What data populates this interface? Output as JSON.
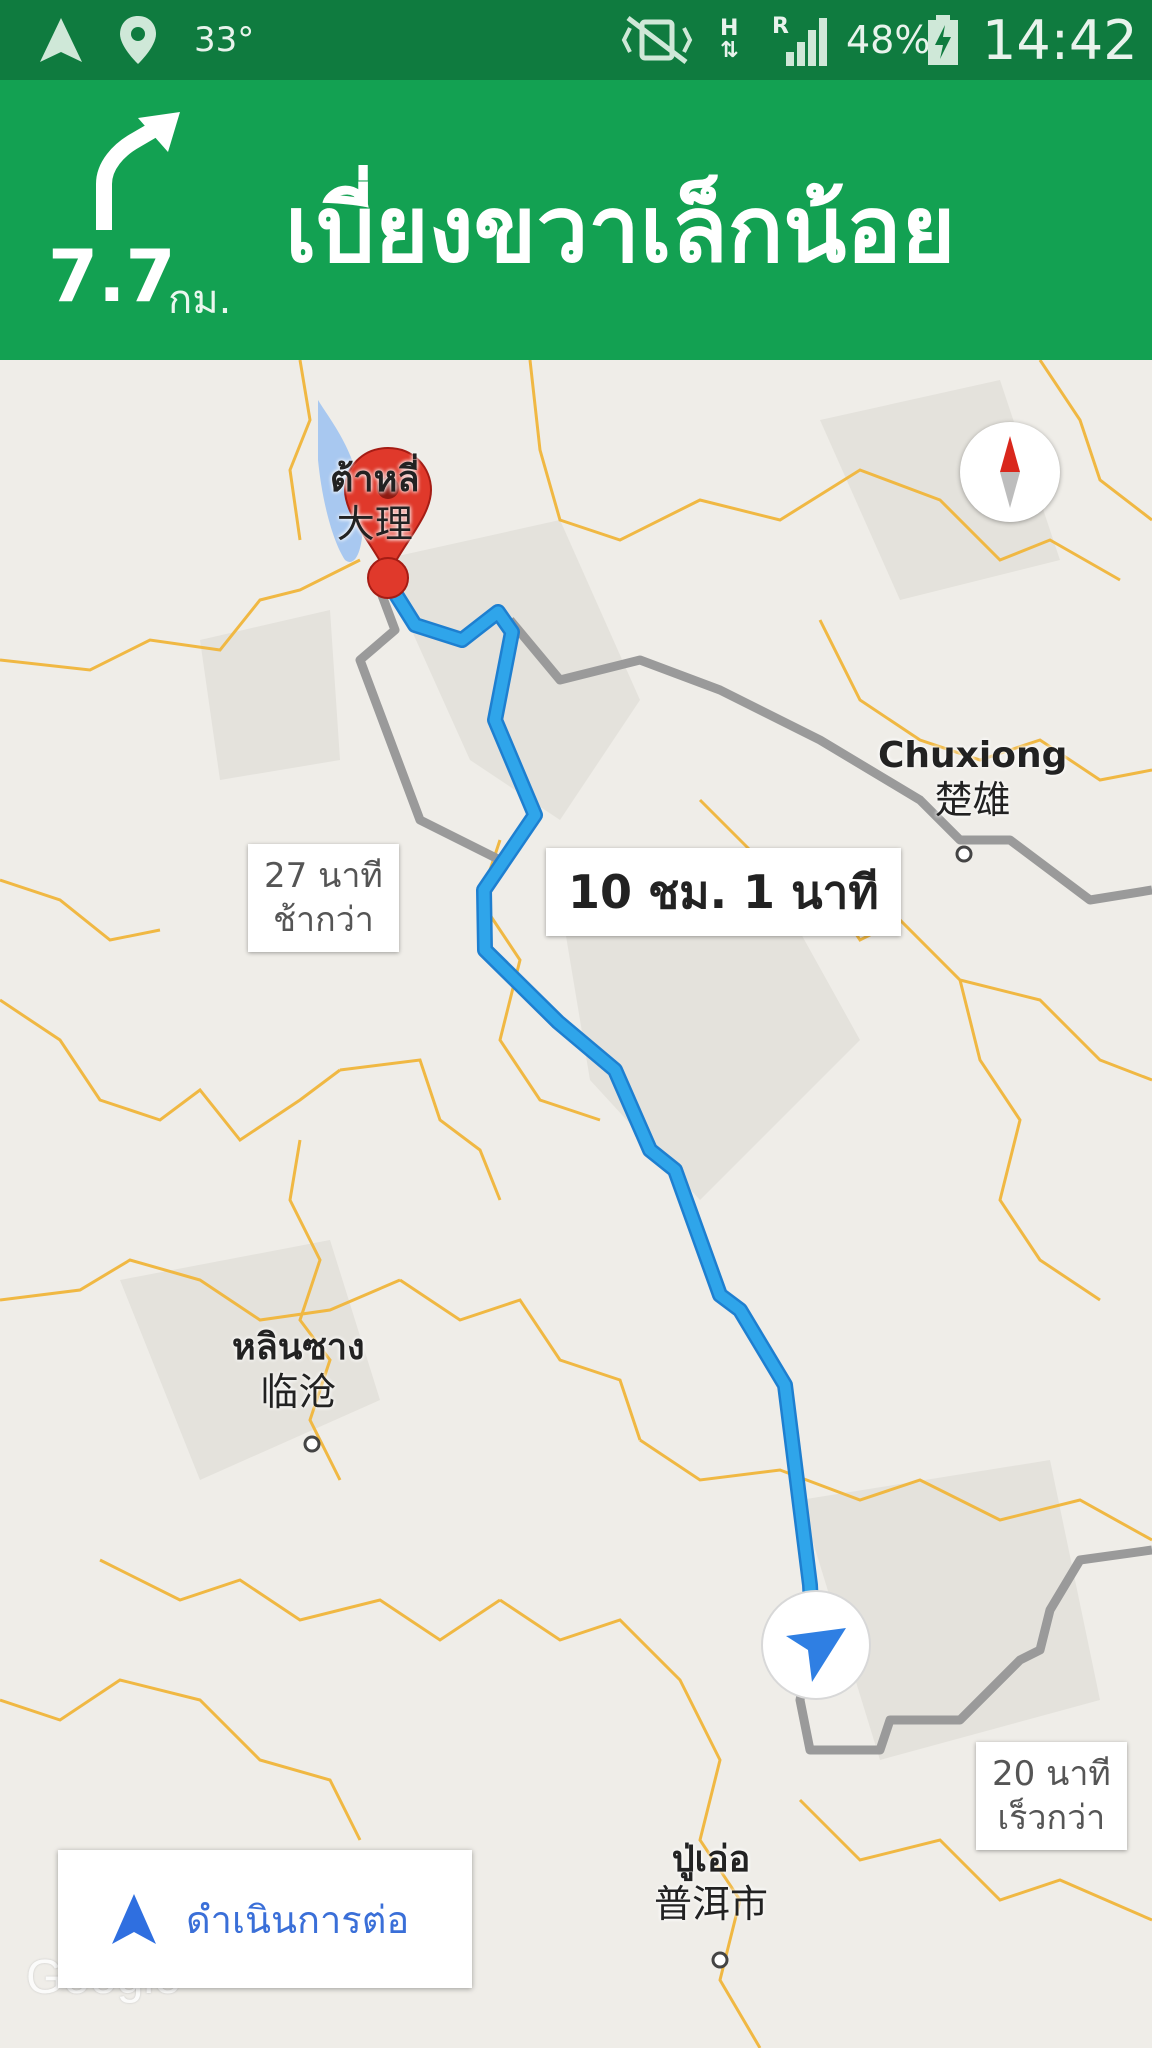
{
  "status_bar": {
    "temperature": "33°",
    "network_h": "H",
    "network_r": "R",
    "battery_percent": "48%",
    "time": "14:42",
    "icons": [
      "navigation-arrow-icon",
      "location-pin-icon",
      "vibrate-mute-icon",
      "data-transfer-icon",
      "signal-icon",
      "battery-charging-icon"
    ]
  },
  "navigation": {
    "turn_icon": "slight-right-arrow-icon",
    "distance_value": "7.7",
    "distance_unit": "กม.",
    "instruction": "เบี่ยงขวาเล็กน้อย"
  },
  "map": {
    "route_time": "10 ชม. 1 นาที",
    "alt_routes": [
      {
        "line1": "27 นาที",
        "line2": "ช้ากว่า"
      },
      {
        "line1": "20 นาที",
        "line2": "เร็วกว่า"
      }
    ],
    "places": [
      {
        "name": "ต้าหลี่",
        "native": "大理"
      },
      {
        "name": "Chuxiong",
        "native": "楚雄"
      },
      {
        "name": "หลินซาง",
        "native": "临沧"
      },
      {
        "name": "ปู่เอ่อ",
        "native": "普洱市"
      }
    ],
    "compass_icon": "compass-icon",
    "watermark": "Google",
    "colors": {
      "route": "#2fa5ea",
      "alt_route": "#9a9a9a",
      "border": "#f0b843",
      "header": "#13a152",
      "statusbar": "#0f7b3f"
    }
  },
  "resume_button": {
    "label": "ดำเนินการต่อ",
    "icon": "navigation-arrow-icon"
  }
}
